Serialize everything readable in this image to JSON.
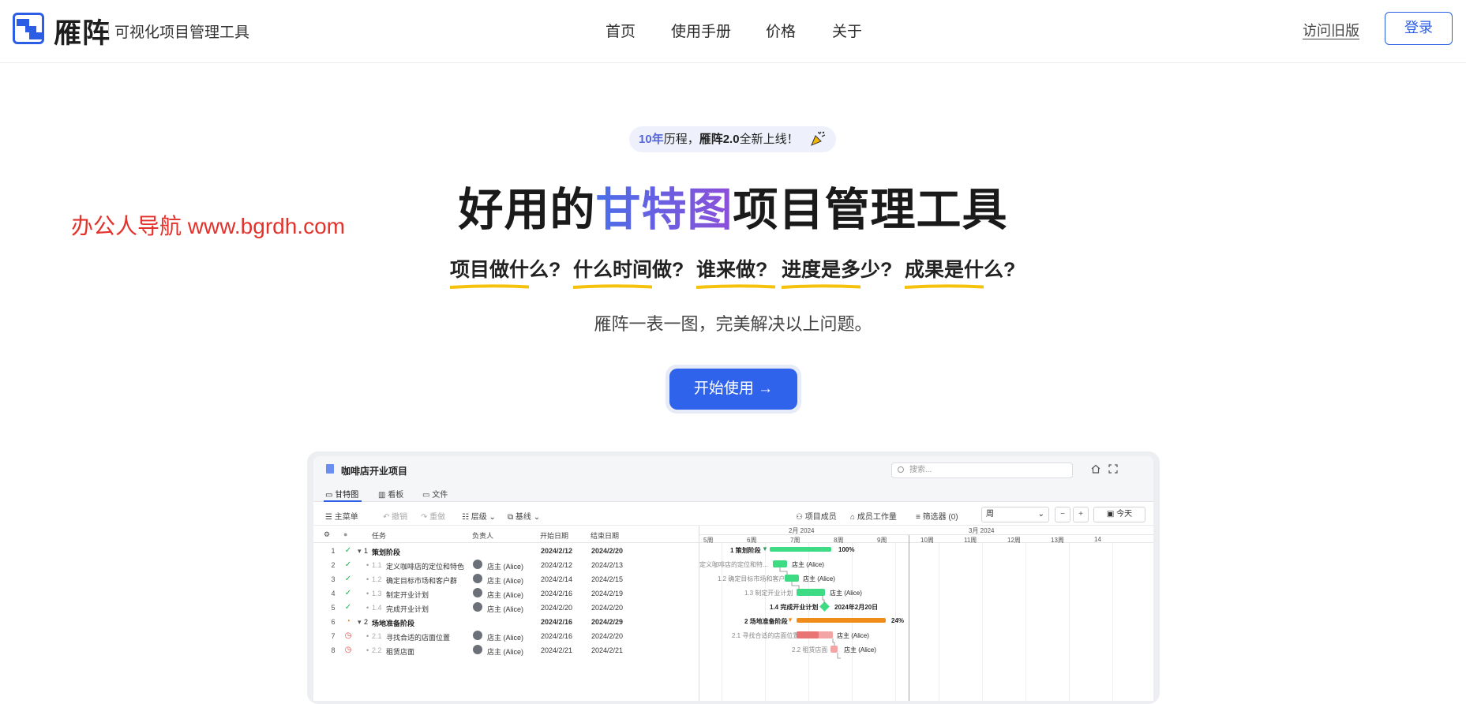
{
  "header": {
    "brand": "雁阵",
    "tagline": "可视化项目管理工具",
    "nav": [
      "首页",
      "使用手册",
      "价格",
      "关于"
    ],
    "old_version": "访问旧版",
    "login": "登录"
  },
  "hero": {
    "pill": {
      "years": "10年",
      "text1": "历程，",
      "brand_version": "雁阵2.0",
      "text2": "全新上线！"
    },
    "title_pre": "好用的",
    "title_highlight": "甘特图",
    "title_post": "项目管理工具",
    "watermark": "办公人导航 www.bgrdh.com",
    "questions": [
      "项目做什么?",
      "什么时间做?",
      "谁来做?",
      "进度是多少?",
      "成果是什么?"
    ],
    "subtitle": "雁阵一表一图，完美解决以上问题。",
    "cta": "开始使用 →"
  },
  "app": {
    "project_title": "咖啡店开业项目",
    "search_placeholder": "搜索...",
    "tabs": [
      "甘特图",
      "看板",
      "文件"
    ],
    "toolbar": {
      "menu": "主菜单",
      "undo": "撤销",
      "redo": "重做",
      "level": "层级",
      "baseline": "基线",
      "members": "项目成员",
      "workload": "成员工作量",
      "filter": "筛选器 (0)",
      "period": "周",
      "today": "今天"
    },
    "columns": {
      "task": "任务",
      "owner": "负责人",
      "start": "开始日期",
      "end": "结束日期"
    },
    "timeline": {
      "months": [
        "2月 2024",
        "3月 2024"
      ],
      "weeks": [
        "5周",
        "6周",
        "7周",
        "8周",
        "9周",
        "10周",
        "11周",
        "12周",
        "13周",
        "14"
      ]
    },
    "rows": [
      {
        "num": "1",
        "status": "done",
        "wbs": "1",
        "name": "策划阶段",
        "group": true,
        "owner": "",
        "start": "2024/2/12",
        "end": "2024/2/20"
      },
      {
        "num": "2",
        "status": "done",
        "wbs": "1.1",
        "name": "定义咖啡店的定位和特色",
        "group": false,
        "owner": "店主 (Alice)",
        "start": "2024/2/12",
        "end": "2024/2/13"
      },
      {
        "num": "3",
        "status": "done",
        "wbs": "1.2",
        "name": "确定目标市场和客户群",
        "group": false,
        "owner": "店主 (Alice)",
        "start": "2024/2/14",
        "end": "2024/2/15"
      },
      {
        "num": "4",
        "status": "done",
        "wbs": "1.3",
        "name": "制定开业计划",
        "group": false,
        "owner": "店主 (Alice)",
        "start": "2024/2/16",
        "end": "2024/2/19"
      },
      {
        "num": "5",
        "status": "done",
        "wbs": "1.4",
        "name": "完成开业计划",
        "group": false,
        "owner": "店主 (Alice)",
        "start": "2024/2/20",
        "end": "2024/2/20"
      },
      {
        "num": "6",
        "status": "progress",
        "wbs": "2",
        "name": "场地准备阶段",
        "group": true,
        "owner": "",
        "start": "2024/2/16",
        "end": "2024/2/29"
      },
      {
        "num": "7",
        "status": "late",
        "wbs": "2.1",
        "name": "寻找合适的店面位置",
        "group": false,
        "owner": "店主 (Alice)",
        "start": "2024/2/16",
        "end": "2024/2/20"
      },
      {
        "num": "8",
        "status": "late",
        "wbs": "2.2",
        "name": "租赁店面",
        "group": false,
        "owner": "店主 (Alice)",
        "start": "2024/2/21",
        "end": "2024/2/21"
      }
    ],
    "gantt_labels": {
      "g1": "1  策划阶段",
      "g1_pct": "100%",
      "t11": "定义咖啡店的定位和特...",
      "t11_owner": "店主 (Alice)",
      "t12": "1.2  确定目标市场和客户群",
      "t12_owner": "店主 (Alice)",
      "t13": "1.3  制定开业计划",
      "t13_owner": "店主 (Alice)",
      "t14": "1.4  完成开业计划",
      "t14_date": "2024年2月20日",
      "g2": "2  场地准备阶段",
      "g2_pct": "24%",
      "t21": "2.1  寻找合适的店面位置",
      "t21_owner": "店主 (Alice)",
      "t22": "2.2  租赁店面",
      "t22_owner": "店主 (Alice)"
    }
  },
  "colors": {
    "brand_blue": "#2b5ee5",
    "done_green": "#22b04a",
    "bar_green": "#3ddc84",
    "progress_orange": "#f08c1a",
    "late_red": "#e24a4a",
    "highlight_yellow": "#f4c20d",
    "watermark_red": "#e3322b"
  }
}
